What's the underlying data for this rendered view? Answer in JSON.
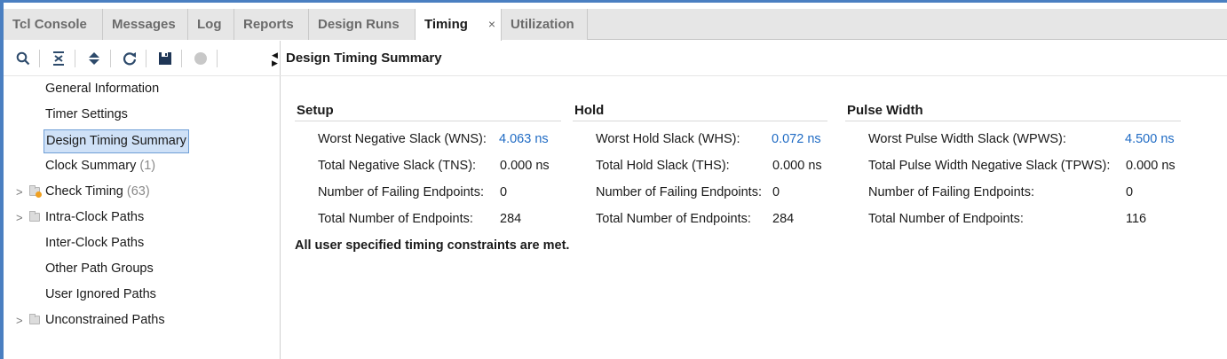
{
  "tabs": [
    {
      "label": "Tcl Console",
      "active": false
    },
    {
      "label": "Messages",
      "active": false
    },
    {
      "label": "Log",
      "active": false
    },
    {
      "label": "Reports",
      "active": false
    },
    {
      "label": "Design Runs",
      "active": false
    },
    {
      "label": "Timing",
      "active": true,
      "close": "×"
    },
    {
      "label": "Utilization",
      "active": false
    }
  ],
  "toolbar": {
    "icons": [
      "search-icon",
      "collapse-all-icon",
      "expand-all-icon",
      "refresh-icon",
      "save-icon",
      "stop-icon"
    ]
  },
  "tree": [
    {
      "label": "General Information",
      "count": "",
      "expandable": false,
      "folder": false
    },
    {
      "label": "Timer Settings",
      "count": "",
      "expandable": false,
      "folder": false
    },
    {
      "label": "Design Timing Summary",
      "count": "",
      "expandable": false,
      "folder": false,
      "selected": true
    },
    {
      "label": "Clock Summary",
      "count": "(1)",
      "expandable": false,
      "folder": false
    },
    {
      "label": "Check Timing",
      "count": "(63)",
      "expandable": true,
      "folder": true,
      "warning": true
    },
    {
      "label": "Intra-Clock Paths",
      "count": "",
      "expandable": true,
      "folder": true
    },
    {
      "label": "Inter-Clock Paths",
      "count": "",
      "expandable": false,
      "folder": false
    },
    {
      "label": "Other Path Groups",
      "count": "",
      "expandable": false,
      "folder": false
    },
    {
      "label": "User Ignored Paths",
      "count": "",
      "expandable": false,
      "folder": false
    },
    {
      "label": "Unconstrained Paths",
      "count": "",
      "expandable": true,
      "folder": true
    }
  ],
  "panel": {
    "title": "Design Timing Summary"
  },
  "setup": {
    "heading": "Setup",
    "rows": [
      {
        "label": "Worst Negative Slack (WNS):",
        "value": "4.063 ns",
        "link": true
      },
      {
        "label": "Total Negative Slack (TNS):",
        "value": "0.000 ns",
        "link": false
      },
      {
        "label": "Number of Failing Endpoints:",
        "value": "0",
        "link": false
      },
      {
        "label": "Total Number of Endpoints:",
        "value": "284",
        "link": false
      }
    ]
  },
  "hold": {
    "heading": "Hold",
    "rows": [
      {
        "label": "Worst Hold Slack (WHS):",
        "value": "0.072 ns",
        "link": true
      },
      {
        "label": "Total Hold Slack (THS):",
        "value": "0.000 ns",
        "link": false
      },
      {
        "label": "Number of Failing Endpoints:",
        "value": "0",
        "link": false
      },
      {
        "label": "Total Number of Endpoints:",
        "value": "284",
        "link": false
      }
    ]
  },
  "pulse": {
    "heading": "Pulse Width",
    "rows": [
      {
        "label": "Worst Pulse Width Slack (WPWS):",
        "value": "4.500 ns",
        "link": true
      },
      {
        "label": "Total Pulse Width Negative Slack (TPWS):",
        "value": "0.000 ns",
        "link": false
      },
      {
        "label": "Number of Failing Endpoints:",
        "value": "0",
        "link": false
      },
      {
        "label": "Total Number of Endpoints:",
        "value": "116",
        "link": false
      }
    ]
  },
  "status_message": "All user specified timing constraints are met.",
  "colors": {
    "accent": "#4a7fc1",
    "link": "#1f6bc4",
    "selection": "#cfe1f7",
    "warning": "#f0a020"
  }
}
